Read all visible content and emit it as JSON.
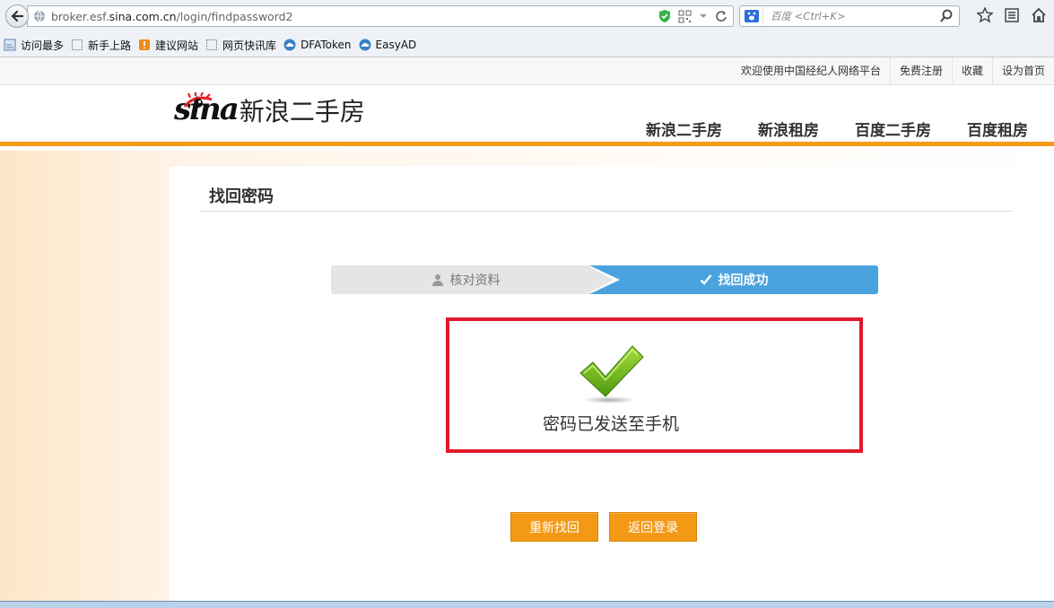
{
  "browser": {
    "url_prefix": "broker.esf.",
    "url_domain": "sina.com.cn",
    "url_path": "/login/findpassword2",
    "search_placeholder": "百度 <Ctrl+K>"
  },
  "bookmarks": [
    {
      "label": "访问最多"
    },
    {
      "label": "新手上路"
    },
    {
      "label": "建议网站"
    },
    {
      "label": "网页快讯库"
    },
    {
      "label": "DFAToken"
    },
    {
      "label": "EasyAD"
    }
  ],
  "topbar": {
    "welcome": "欢迎使用中国经纪人网络平台",
    "register": "免费注册",
    "favorite": "收藏",
    "homepage": "设为首页"
  },
  "header": {
    "logo_sina": "sina",
    "logo_cn": "新浪二手房",
    "nav": [
      "新浪二手房",
      "新浪租房",
      "百度二手房",
      "百度租房"
    ]
  },
  "panel": {
    "title": "找回密码",
    "step1": "核对资料",
    "step2": "找回成功",
    "success_message": "密码已发送至手机",
    "retry_button": "重新找回",
    "back_button": "返回登录"
  },
  "colors": {
    "accent_orange": "#f39915",
    "step_blue": "#4aa3de",
    "highlight_red": "#e2192b"
  }
}
